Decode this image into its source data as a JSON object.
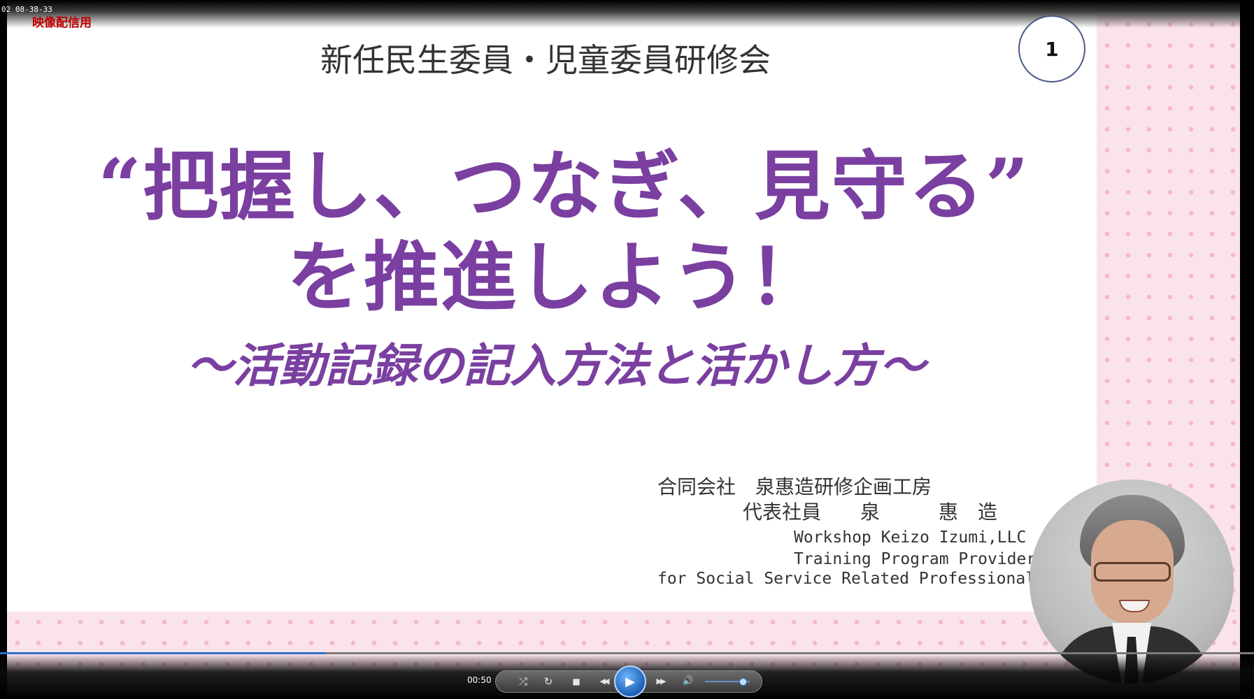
{
  "overlay": {
    "timestamp": "02 08-38-33",
    "watermark": "映像配信用"
  },
  "slide": {
    "header": "新任民生委員・児童委員研修会",
    "page_number": "1",
    "title_line1": "“把握し、つなぎ、見守る”",
    "title_line2": "を推進しよう！",
    "subtitle": "～活動記録の記入方法と活かし方～",
    "org_jp": "合同会社　泉惠造研修企画工房",
    "rep_jp": "代表社員　　泉　　　惠　造",
    "org_en_line1": "Workshop Keizo Izumi,LLC",
    "org_en_line2": "Training Program Provider",
    "org_en_line3": "for Social Service Related Professionals"
  },
  "player": {
    "current_time": "00:50",
    "progress": 0.26,
    "volume": 0.85,
    "accent_color": "#2f6fcf",
    "icons": {
      "shuffle": "⤮",
      "repeat": "↻",
      "stop": "■",
      "rewind": "◀◀",
      "play": "▶",
      "fast_forward": "▶▶",
      "volume": "🔊"
    }
  },
  "colors": {
    "title": "#7a3fa0",
    "dots_bg": "#fbe3ec",
    "dots": "#f3b9cf"
  }
}
